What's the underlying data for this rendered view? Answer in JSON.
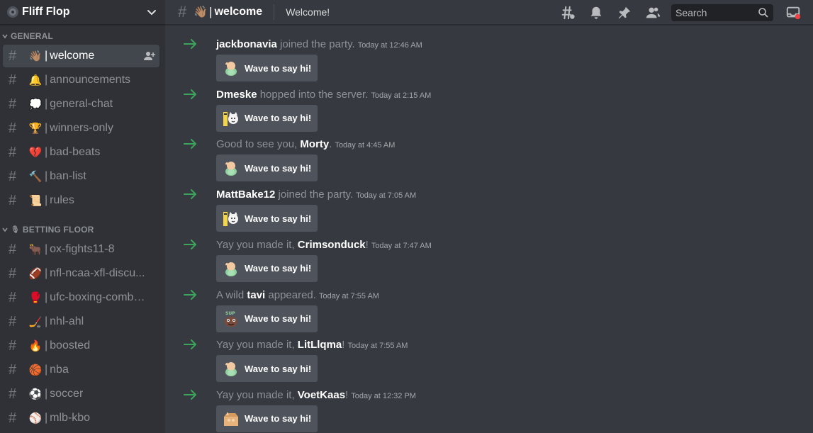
{
  "server": {
    "name": "Fliff Flop"
  },
  "categories": [
    {
      "label": "GENERAL",
      "emoji": ""
    },
    {
      "label": "BETTING FLOOR",
      "emoji": "🎙"
    }
  ],
  "general_channels": [
    {
      "emoji": "👋🏽",
      "name": "welcome",
      "active": true
    },
    {
      "emoji": "🔔",
      "name": "announcements"
    },
    {
      "emoji": "💭",
      "name": "general-chat"
    },
    {
      "emoji": "🏆",
      "name": "winners-only"
    },
    {
      "emoji": "💔",
      "name": "bad-beats"
    },
    {
      "emoji": "🔨",
      "name": "ban-list"
    },
    {
      "emoji": "📜",
      "name": "rules"
    }
  ],
  "betting_channels": [
    {
      "emoji": "🐂",
      "name": "ox-fights11-8"
    },
    {
      "emoji": "🏈",
      "name": "nfl-ncaa-xfl-discu..."
    },
    {
      "emoji": "🥊",
      "name": "ufc-boxing-comba..."
    },
    {
      "emoji": "🏒",
      "name": "nhl-ahl"
    },
    {
      "emoji": "🔥",
      "name": "boosted"
    },
    {
      "emoji": "🏀",
      "name": "nba"
    },
    {
      "emoji": "⚽",
      "name": "soccer"
    },
    {
      "emoji": "⚾",
      "name": "mlb-kbo"
    }
  ],
  "header": {
    "hash": "#",
    "channel_emoji": "👋🏽",
    "separator": "|",
    "channel_name": "welcome",
    "topic": "Welcome!"
  },
  "search": {
    "placeholder": "Search"
  },
  "separator": "|",
  "hash": "#",
  "wave_label": "Wave to say hi!",
  "messages": [
    {
      "pre": "",
      "user": "jackbonavia",
      "post": " joined the party.",
      "time": "Today at 12:46 AM",
      "sticker": "wumpus-wave"
    },
    {
      "pre": "",
      "user": "Dmeske",
      "post": " hopped into the server.",
      "time": "Today at 2:15 AM",
      "sticker": "cat-sign"
    },
    {
      "pre": "Good to see you, ",
      "user": "Morty",
      "post": ".",
      "time": "Today at 4:45 AM",
      "sticker": "wumpus-wave"
    },
    {
      "pre": "",
      "user": "MattBake12",
      "post": " joined the party.",
      "time": "Today at 7:05 AM",
      "sticker": "cat-sign"
    },
    {
      "pre": "Yay you made it, ",
      "user": "Crimsonduck",
      "post": "!",
      "time": "Today at 7:47 AM",
      "sticker": "wumpus-wave"
    },
    {
      "pre": "A wild ",
      "user": "tavi",
      "post": " appeared.",
      "time": "Today at 7:55 AM",
      "sticker": "sup-creature"
    },
    {
      "pre": "Yay you made it, ",
      "user": "LitLlqma",
      "post": "!",
      "time": "Today at 7:55 AM",
      "sticker": "wumpus-wave"
    },
    {
      "pre": "Yay you made it, ",
      "user": "VoetKaas",
      "post": "!",
      "time": "Today at 12:32 PM",
      "sticker": "box-wave"
    }
  ],
  "colors": {
    "sidebar_bg": "#2f3136",
    "main_bg": "#36393f",
    "active_channel": "#42464d",
    "join_arrow": "#3ba55c",
    "button_bg": "#4f545c"
  }
}
